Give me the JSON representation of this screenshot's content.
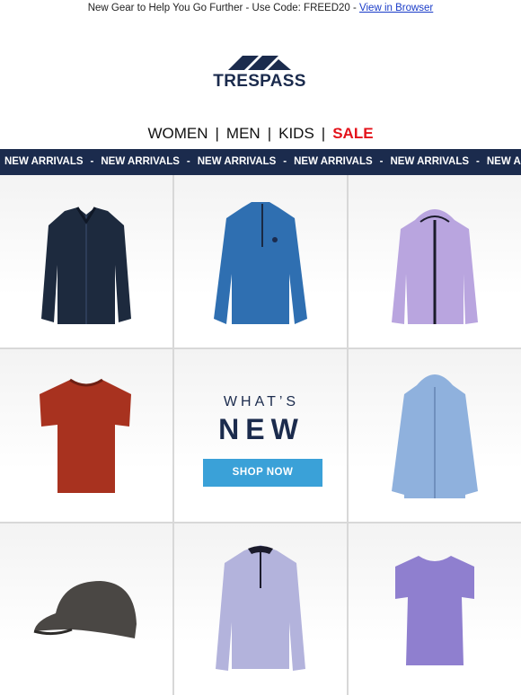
{
  "preheader": {
    "text": "New Gear to Help You Go Further - Use Code: FREED20 - ",
    "link": "View in Browser"
  },
  "brand": {
    "logo_text": "TRESPASS"
  },
  "nav": {
    "women": "WOMEN",
    "men": "MEN",
    "kids": "KIDS",
    "sale": "SALE",
    "separator": "|"
  },
  "ticker": {
    "items": [
      "NEW ARRIVALS",
      "NEW ARRIVALS",
      "NEW ARRIVALS",
      "NEW ARRIVALS",
      "NEW ARRIVALS",
      "NEW ARRIVALS"
    ],
    "separator": "-"
  },
  "promo": {
    "line1": "WHAT’S",
    "line2": "NEW",
    "button": "SHOP NOW"
  },
  "colors": {
    "navy": "#1b2b4d",
    "sale_red": "#e4131b",
    "button_blue": "#3aa1d8"
  },
  "products": [
    {
      "icon": "navy-shirt-jacket-image",
      "color": "#1d2a3e"
    },
    {
      "icon": "blue-half-zip-fleece-image",
      "color": "#2f6fb1"
    },
    {
      "icon": "lilac-hooded-jacket-image",
      "color": "#b9a5df"
    },
    {
      "icon": "red-tshirt-image",
      "color": "#a8321f"
    },
    {
      "icon": "light-blue-parka-image",
      "color": "#8fb1dd"
    },
    {
      "icon": "grey-cap-image",
      "color": "#4a4744"
    },
    {
      "icon": "lilac-half-zip-fleece-image",
      "color": "#b3b3dc"
    },
    {
      "icon": "purple-tshirt-image",
      "color": "#8f7fcf"
    }
  ]
}
